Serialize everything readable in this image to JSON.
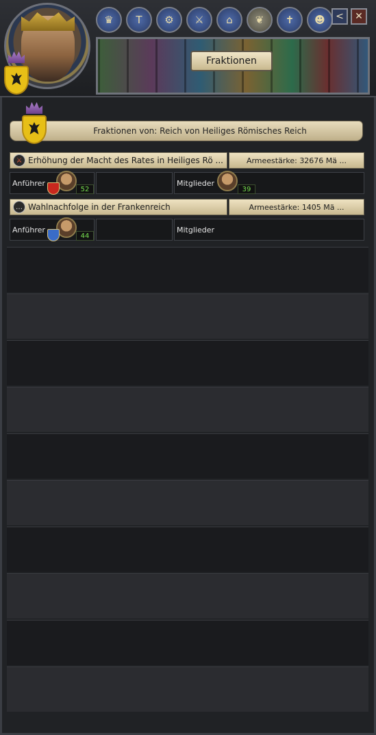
{
  "header": {
    "title": "Fraktionen",
    "tabs": [
      {
        "icon": "crown-icon",
        "glyph": "♛"
      },
      {
        "icon": "hammer-icon",
        "glyph": "T"
      },
      {
        "icon": "gear-icon",
        "glyph": "⚙"
      },
      {
        "icon": "sword-icon",
        "glyph": "⚔"
      },
      {
        "icon": "scroll-icon",
        "glyph": "⌂"
      },
      {
        "icon": "faction-icon",
        "glyph": "❦"
      },
      {
        "icon": "cross-icon",
        "glyph": "✝"
      },
      {
        "icon": "people-icon",
        "glyph": "☻"
      }
    ],
    "back_glyph": "<",
    "close_glyph": "✕"
  },
  "banner": {
    "text": "Fraktionen von: Reich von Heiliges Römisches Reich"
  },
  "factions": [
    {
      "name": "Erhöhung der Macht des Rates in Heiliges Rö ...",
      "army": "Armeestärke: 32676 Mä ...",
      "leader_label": "Anführer",
      "leader_count": "52",
      "members_label": "Mitglieder",
      "members_count": "39",
      "icon": "sword-icon"
    },
    {
      "name": "Wahlnachfolge in der Frankenreich",
      "army": "Armeestärke: 1405 Mä ...",
      "leader_label": "Anführer",
      "leader_count": "44",
      "members_label": "Mitglieder",
      "icon": "speech-icon"
    }
  ]
}
